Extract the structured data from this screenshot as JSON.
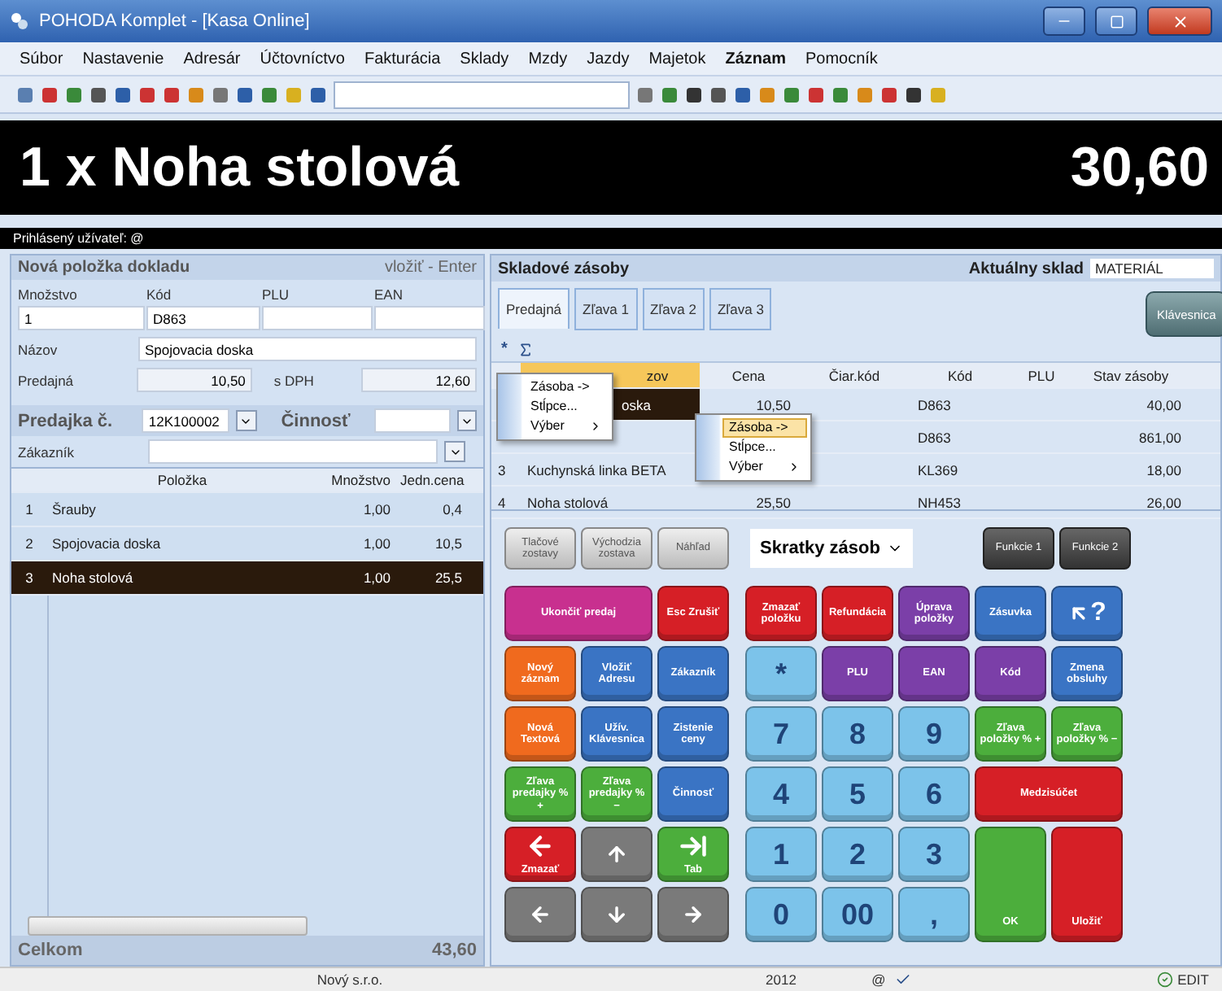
{
  "window": {
    "title": "POHODA Komplet - [Kasa Online]"
  },
  "menu": [
    {
      "label": "Súbor",
      "active": false
    },
    {
      "label": "Nastavenie",
      "active": false
    },
    {
      "label": "Adresár",
      "active": false
    },
    {
      "label": "Účtovníctvo",
      "active": false
    },
    {
      "label": "Fakturácia",
      "active": false
    },
    {
      "label": "Sklady",
      "active": false
    },
    {
      "label": "Mzdy",
      "active": false
    },
    {
      "label": "Jazdy",
      "active": false
    },
    {
      "label": "Majetok",
      "active": false
    },
    {
      "label": "Záznam",
      "active": true
    },
    {
      "label": "Pomocník",
      "active": false
    }
  ],
  "banner": {
    "item": "1 x Noha stolová",
    "total": "30,60"
  },
  "user_bar": {
    "label": "Prihlásený užívateľ: @"
  },
  "new_item": {
    "title": "Nová položka dokladu",
    "hint": "vložiť - Enter",
    "columns": [
      "Množstvo",
      "Kód",
      "PLU",
      "EAN"
    ],
    "values": [
      "1",
      "D863"
    ],
    "name_label": "Názov",
    "name": "Spojovacia doska",
    "price_label": "Predajná",
    "price": "10,50",
    "vat_label": "s DPH",
    "price_vat": "12,60"
  },
  "receipt": {
    "label": "Predajka č.",
    "number": "12K100002",
    "activity_label": "Činnosť",
    "customer_label": "Zákazník",
    "columns": [
      "Položka",
      "Množstvo",
      "Jedn.cena"
    ],
    "rows": [
      {
        "num": "1",
        "item": "Šrauby",
        "qty": "1,00",
        "price": "0,4",
        "selected": false
      },
      {
        "num": "2",
        "item": "Spojovacia doska",
        "qty": "1,00",
        "price": "10,5",
        "selected": false
      },
      {
        "num": "3",
        "item": "Noha stolová",
        "qty": "1,00",
        "price": "25,5",
        "selected": true
      }
    ],
    "total_label": "Celkom",
    "total": "43,60"
  },
  "stock": {
    "title": "Skladové zásoby",
    "warehouse_label": "Aktuálny sklad",
    "warehouse": "MATERIÁL",
    "tabs": [
      {
        "label": "Predajná",
        "selected": true
      },
      {
        "label": "Zľava 1",
        "selected": false
      },
      {
        "label": "Zľava 2",
        "selected": false
      },
      {
        "label": "Zľava 3",
        "selected": false
      }
    ],
    "keyboard_button": "Klávesnica",
    "filter_star": "*",
    "columns": [
      {
        "label": "zov",
        "covered": true,
        "selected": true
      },
      {
        "label": "Cena",
        "covered": false,
        "selected": false
      },
      {
        "label": "Čiar.kód",
        "covered": false,
        "selected": false
      },
      {
        "label": "Kód",
        "covered": false,
        "selected": false
      },
      {
        "label": "PLU",
        "covered": false,
        "selected": false
      },
      {
        "label": "Stav zásoby",
        "covered": false,
        "selected": false
      }
    ],
    "rows": [
      {
        "name": "oska",
        "covered": true,
        "price": "10,50",
        "code": "D863",
        "stock": "40,00",
        "selected": true
      },
      {
        "code": "D863",
        "stock": "861,00",
        "selected": false
      },
      {
        "num": "3",
        "name": "Kuchynská linka BETA",
        "code": "KL369",
        "stock": "18,00",
        "covered": false,
        "selected": false
      },
      {
        "num": "4",
        "name": "Noha stolová",
        "price": "25,50",
        "code": "NH453",
        "stock": "26,00",
        "covered": false,
        "selected": false
      }
    ],
    "context_menus": [
      {
        "items": [
          {
            "label": "Zásoba ->",
            "selected": false,
            "submenu": false
          },
          {
            "label": "Stĺpce...",
            "selected": false,
            "submenu": false
          },
          {
            "label": "Výber",
            "selected": false,
            "submenu": true
          }
        ]
      },
      {
        "items": [
          {
            "label": "Zásoba ->",
            "selected": true,
            "submenu": false
          },
          {
            "label": "Stĺpce...",
            "selected": false,
            "submenu": false
          },
          {
            "label": "Výber",
            "selected": false,
            "submenu": true
          }
        ]
      }
    ]
  },
  "report_buttons": [
    "Tlačové zostavy",
    "Východzia zostava",
    "Náhľad"
  ],
  "shortcuts": {
    "label": "Skratky zásob"
  },
  "function_buttons": [
    "Funkcie 1",
    "Funkcie 2"
  ],
  "keys_left": [
    {
      "kind": "text",
      "label": "Ukončiť predaj",
      "color": "#c8308f"
    },
    {
      "kind": "text",
      "label": "Esc Zrušiť",
      "color": "#d61f26"
    },
    {
      "kind": "text",
      "label": "Nový záznam",
      "color": "#f06a1e"
    },
    {
      "kind": "text",
      "label": "Vložiť Adresu",
      "color": "#3a74c4"
    },
    {
      "kind": "text",
      "label": "Zákazník",
      "color": "#3a74c4"
    },
    {
      "kind": "text",
      "label": "Nová Textová",
      "color": "#f06a1e"
    },
    {
      "kind": "text",
      "label": "Užív. Klávesnica",
      "color": "#3a74c4"
    },
    {
      "kind": "text",
      "label": "Zistenie ceny",
      "color": "#3a74c4"
    },
    {
      "kind": "text",
      "label": "Zľava predajky % +",
      "color": "#4cae3c"
    },
    {
      "kind": "text",
      "label": "Zľava predajky % −",
      "color": "#4cae3c"
    },
    {
      "kind": "text",
      "label": "Činnosť",
      "color": "#3a74c4"
    },
    {
      "kind": "backspace",
      "label": "Zmazať",
      "color": "#d61f26"
    },
    {
      "kind": "up",
      "color": "#7a7a7a"
    },
    {
      "kind": "tab",
      "label": "Tab",
      "color": "#4cae3c"
    },
    {
      "kind": "left",
      "color": "#7a7a7a"
    },
    {
      "kind": "down",
      "color": "#7a7a7a"
    },
    {
      "kind": "right",
      "color": "#7a7a7a"
    }
  ],
  "keys_right": [
    {
      "kind": "text",
      "label": "Zmazať položku",
      "color": "#d61f26"
    },
    {
      "kind": "text",
      "label": "Refundácia",
      "color": "#d61f26"
    },
    {
      "kind": "text",
      "label": "Úprava položky",
      "color": "#7b3fa8"
    },
    {
      "kind": "text",
      "label": "Zásuvka",
      "color": "#3a74c4"
    },
    {
      "kind": "help",
      "label": "?",
      "color": "#3a74c4"
    },
    {
      "kind": "digit",
      "label": "*",
      "color": "#7cc3ea"
    },
    {
      "kind": "text",
      "label": "PLU",
      "color": "#7b3fa8"
    },
    {
      "kind": "text",
      "label": "EAN",
      "color": "#7b3fa8"
    },
    {
      "kind": "text",
      "label": "Kód",
      "color": "#7b3fa8"
    },
    {
      "kind": "text",
      "label": "Zmena obsluhy",
      "color": "#3a74c4"
    },
    {
      "kind": "digit",
      "label": "7",
      "color": "#7cc3ea"
    },
    {
      "kind": "digit",
      "label": "8",
      "color": "#7cc3ea"
    },
    {
      "kind": "digit",
      "label": "9",
      "color": "#7cc3ea"
    },
    {
      "kind": "text",
      "label": "Zľava položky % +",
      "color": "#4cae3c"
    },
    {
      "kind": "text",
      "label": "Zľava položky % −",
      "color": "#4cae3c"
    },
    {
      "kind": "digit",
      "label": "4",
      "color": "#7cc3ea"
    },
    {
      "kind": "digit",
      "label": "5",
      "color": "#7cc3ea"
    },
    {
      "kind": "digit",
      "label": "6",
      "color": "#7cc3ea"
    },
    {
      "kind": "text",
      "label": "Medzisúčet",
      "color": "#d61f26"
    },
    {
      "kind": "digit",
      "label": "1",
      "color": "#7cc3ea"
    },
    {
      "kind": "digit",
      "label": "2",
      "color": "#7cc3ea"
    },
    {
      "kind": "digit",
      "label": "3",
      "color": "#7cc3ea"
    },
    {
      "kind": "digit",
      "label": "0",
      "color": "#7cc3ea"
    },
    {
      "kind": "digit",
      "label": "00",
      "color": "#7cc3ea"
    },
    {
      "kind": "digit",
      "label": ",",
      "color": "#7cc3ea"
    },
    {
      "kind": "bottom",
      "label": "OK",
      "color": "#4cae3c"
    },
    {
      "kind": "bottom",
      "label": "Uložiť",
      "color": "#d61f26"
    }
  ],
  "status_bar": {
    "company": "Nový s.r.o.",
    "year": "2012",
    "at": "@",
    "mode": "EDIT"
  }
}
